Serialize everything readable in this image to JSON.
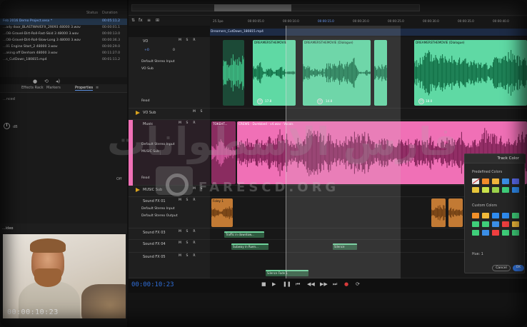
{
  "files": {
    "col_status": "Status",
    "col_duration": "Duration",
    "rows": [
      {
        "name": "Feb 2016 Demo Project.sesx *",
        "dur": "00:05:11.2",
        "selected": true
      },
      {
        "name": "...ady door_BLASTWAVEFX_29093 48000 3.wav",
        "dur": "00:00:01.1",
        "selected": false
      },
      {
        "name": "...OB-Gravel-Dirt-Roll-Fast-Skid 3 48000 3.wav",
        "dur": "00:00:13.0",
        "selected": false
      },
      {
        "name": "...OB-Gravel-Dirt-Roll-Slow-Long 3 48000 3.wav",
        "dur": "00:00:36.3",
        "selected": false
      },
      {
        "name": "...01 Engine Start_2 48000 3.wav",
        "dur": "00:00:29.0",
        "selected": false
      },
      {
        "name": "...aking off Denham 48000 3.wav",
        "dur": "00:11:27.0",
        "selected": false
      },
      {
        "name": "...s_CutDown_180815.mp4",
        "dur": "00:01:11.2",
        "selected": false
      }
    ]
  },
  "panel_tabs": {
    "effects": "Effects Rack",
    "markers": "Markers",
    "properties": "Properties"
  },
  "props": {
    "label_top": "...nced",
    "db": "dB",
    "off": "Off"
  },
  "video_tab": "...ideo",
  "video_timecode": "00:00:10:23",
  "timeline": {
    "ruler": [
      "25.5po",
      "00:00:05.0",
      "00:00:10.0",
      "00:00:15.0",
      "00:00:20.0",
      "00:00:25.0",
      "00:00:30.0",
      "00:00:35.0",
      "00:00:40.0",
      "00:00:45.0"
    ],
    "video_file": "Dreamers_CutDown_180815.mp4"
  },
  "tracks": {
    "vo": {
      "name": "VO",
      "input": "Default Stereo Input",
      "output": "VO Sub",
      "read": "Read",
      "vol": "+0",
      "pan": "0"
    },
    "vo_sub": {
      "name": "VO Sub"
    },
    "music": {
      "name": "Music",
      "input": "Default Stereo Input",
      "output": "MUSIC Sub",
      "read": "Read"
    },
    "music_sub": {
      "name": "MUSIC Sub"
    },
    "sfx1": {
      "name": "Sound FX 01",
      "input": "Default Stereo Input",
      "output": "Default Stereo Output"
    },
    "sfx3": {
      "name": "Sound FX 03"
    },
    "sfx4": {
      "name": "Sound FX 04"
    },
    "sfx5": {
      "name": "Sound FX 05"
    }
  },
  "clips": {
    "vo_1": "DREAMERSTHEMOVIE",
    "vo_2": "DREAMERSTHEMOVIE (Dialogue)",
    "vo_3": "DREAMERSTHEMOVIE (Dialogue)",
    "vo_4": "DREAMERSTHEMOVIE (Dialogue)",
    "music_1": "TOKEHT...",
    "music_2": "CREWS - Dumbbed - v4.wav - Vocals",
    "sfx_1": "Foley 1",
    "sfx_2": "Traffic in downtow...",
    "sfx_3": "Subway in Ruen...",
    "sfx_4": "Silence",
    "sfx_5": "Silence Fade 1"
  },
  "fx_numbers": {
    "a": "17.8",
    "b": "14.8",
    "c": "18.0"
  },
  "transport": {
    "timecode": "00:00:10:23"
  },
  "track_color": {
    "title": "Track Color",
    "predefined": "Predefined Colors",
    "custom": "Custom Colors",
    "hue_label": "Hue: 1",
    "cancel": "Cancel",
    "ok": "OK",
    "predefined_swatches": [
      "#e8e8e8",
      "#f08a2a",
      "#f0b43c",
      "#3b8ee6",
      "#5a6bf0",
      "#e6c53a",
      "#c9e14a",
      "#9bd14a",
      "#3fcf7a",
      "#2f8cf0"
    ],
    "custom_swatches": [
      "#f0902a",
      "#f0b93a",
      "#2f8cf0",
      "#2f8cf0",
      "#3fcf7a",
      "#3fcf7a",
      "#3fcf7a",
      "#3b8ee6",
      "#ef3f3f",
      "#f0b93a",
      "#3fcf7a",
      "#3b8ee6",
      "#ef3f3f",
      "#3fcf7a",
      "#3fcf7a",
      "#3b8ee6"
    ]
  },
  "watermark": {
    "arabic": "فارس الاسطوانات",
    "english": "FARESCD.ORG"
  },
  "colors": {
    "accent": "#2f6fd6",
    "vo_green": "#5fd9a4",
    "music_pink": "#f070b6",
    "sfx_orange": "#d98b3a"
  }
}
